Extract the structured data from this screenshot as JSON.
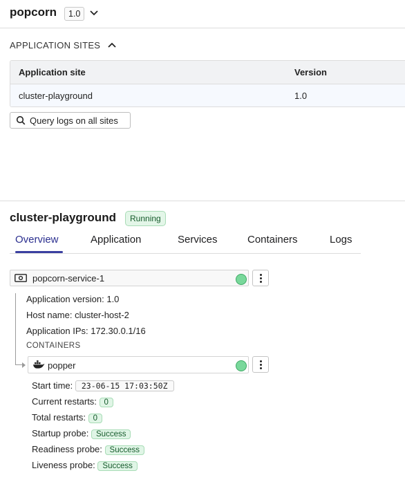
{
  "header": {
    "app_name": "popcorn",
    "version": "1.0"
  },
  "application_sites": {
    "section_title": "APPLICATION SITES",
    "columns": [
      "Application site",
      "Version"
    ],
    "rows": [
      {
        "site": "cluster-playground",
        "version": "1.0"
      }
    ],
    "query_button": "Query logs on all sites"
  },
  "site": {
    "name": "cluster-playground",
    "status": "Running",
    "tabs": [
      "Overview",
      "Application",
      "Services",
      "Containers",
      "Logs"
    ],
    "active_tab": "Overview",
    "service": {
      "name": "popcorn-service-1",
      "icon": "service-icon",
      "application_version": "Application version: 1.0",
      "host_name": "Host name: cluster-host-2",
      "application_ips": "Application IPs: 172.30.0.1/16",
      "containers_label": "CONTAINERS",
      "container": {
        "name": "popper",
        "icon": "docker-icon",
        "start_time_label": "Start time:",
        "start_time": "23-06-15 17:03:50Z",
        "current_restarts_label": "Current restarts:",
        "current_restarts": "0",
        "total_restarts_label": "Total restarts:",
        "total_restarts": "0",
        "startup_probe_label": "Startup probe:",
        "startup_probe": "Success",
        "readiness_probe_label": "Readiness probe:",
        "readiness_probe": "Success",
        "liveness_probe_label": "Liveness probe:",
        "liveness_probe": "Success"
      }
    }
  },
  "colors": {
    "accent": "#3a3fa0",
    "status_green": "#79d89b",
    "badge_bg": "#e3f6e8"
  }
}
